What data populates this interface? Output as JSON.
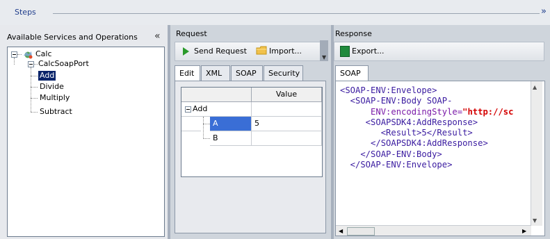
{
  "steps": {
    "label": "Steps",
    "chevron": "»"
  },
  "services": {
    "title": "Available Services and Operations",
    "collapse": "«",
    "tree": {
      "service": "Calc",
      "port": "CalcSoapPort",
      "operations": [
        "Add",
        "Divide",
        "Multiply",
        "Subtract"
      ],
      "selected": "Add"
    }
  },
  "request": {
    "title": "Request",
    "send_label": "Send Request",
    "import_label": "Import...",
    "tabs": [
      "Edit",
      "XML",
      "SOAP",
      "Security"
    ],
    "active_tab": "Edit",
    "grid": {
      "header_value": "Value",
      "root": "Add",
      "rows": [
        {
          "name": "A",
          "value": "5"
        },
        {
          "name": "B",
          "value": ""
        }
      ]
    }
  },
  "response": {
    "title": "Response",
    "export_label": "Export...",
    "tabs": [
      "SOAP"
    ],
    "xml_lines": [
      "<SOAP-ENV:Envelope>",
      "  <SOAP-ENV:Body SOAP-",
      "      ENV:encodingStyle=",
      "     <SOAPSDK4:AddResponse>",
      "        <Result>5</Result>",
      "      </SOAPSDK4:AddResponse>",
      "    </SOAP-ENV:Body>",
      "  </SOAP-ENV:Envelope>"
    ],
    "encoding_value": "\"http://sc"
  },
  "colors": {
    "accent": "#1f3d8c",
    "selection": "#0a246a",
    "xml_tag": "#3a1ba0",
    "xml_value": "#d40000"
  },
  "icons": [
    "service-icon",
    "play-icon",
    "folder-icon",
    "export-icon"
  ]
}
